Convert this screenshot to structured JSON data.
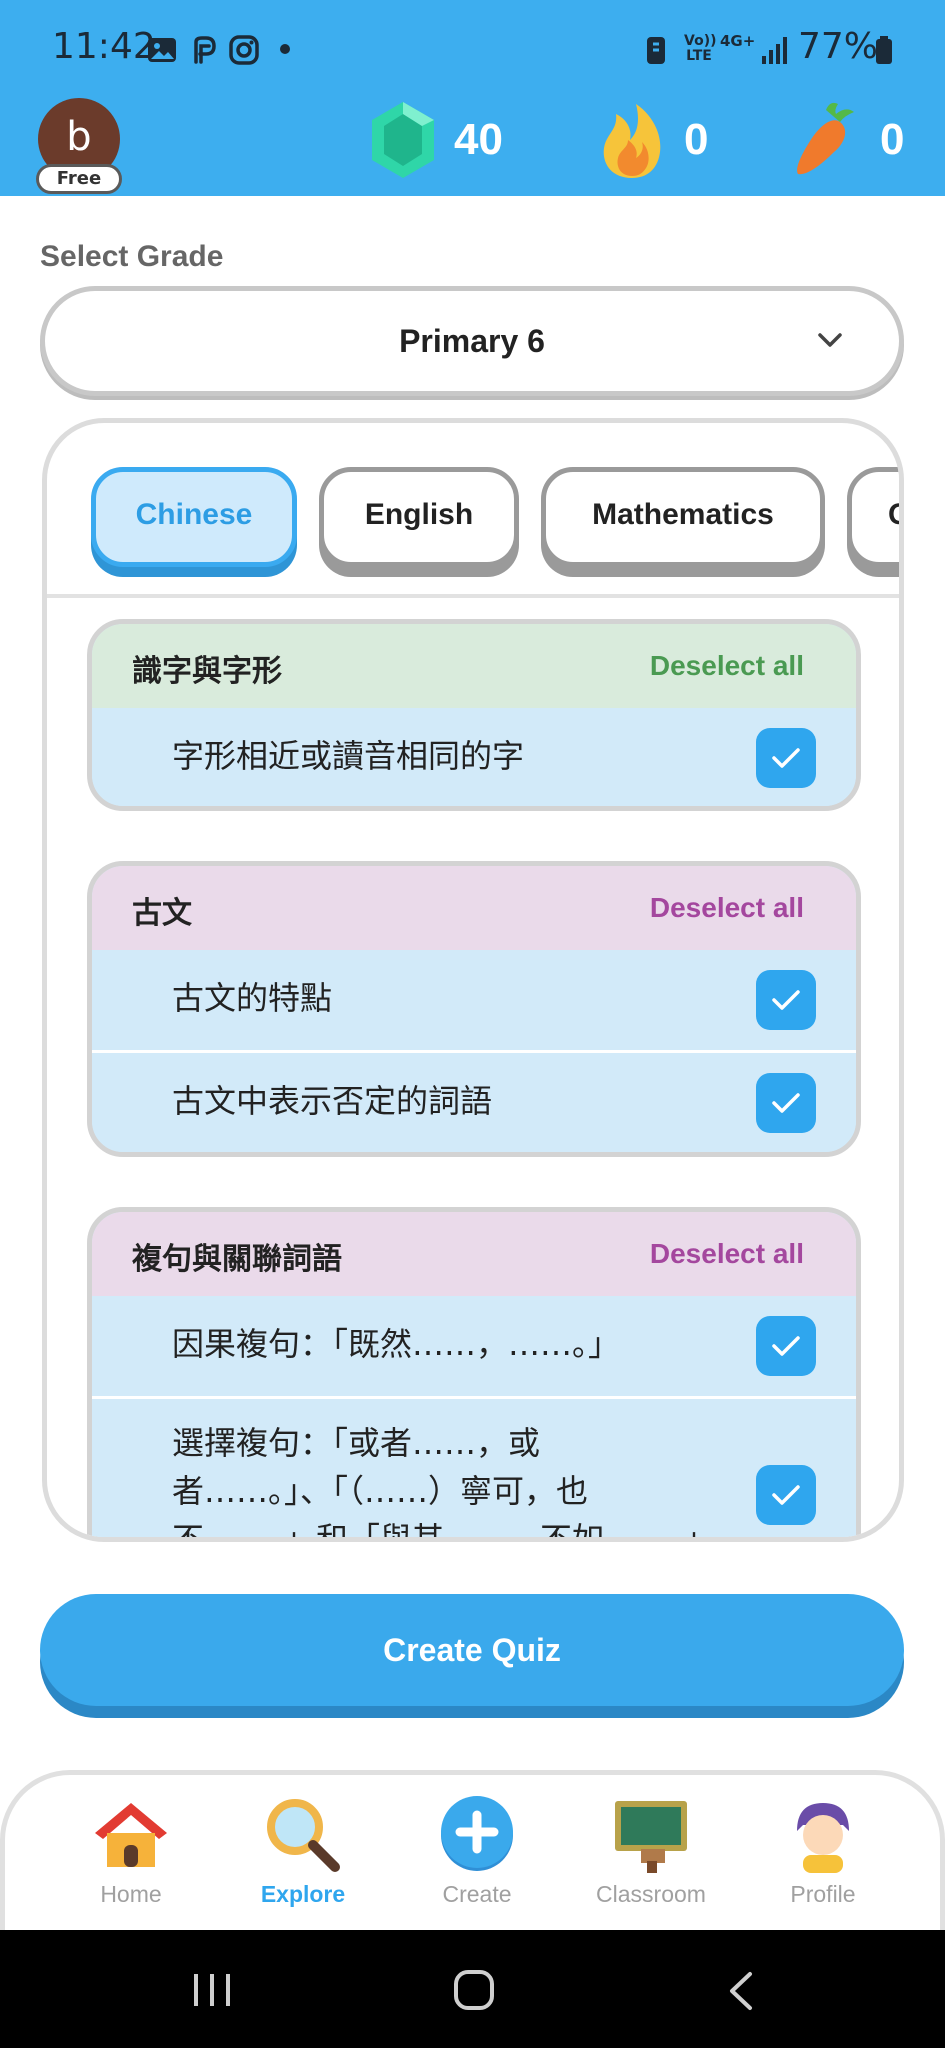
{
  "status_bar": {
    "time": "11:42",
    "signal_lte": "Vo)) LTE",
    "signal_4g": "4G+",
    "battery": "77%"
  },
  "header": {
    "avatar_letter": "b",
    "plan_badge": "Free",
    "gems": "40",
    "streak": "0",
    "carrots": "0"
  },
  "grade": {
    "label": "Select Grade",
    "selected": "Primary 6"
  },
  "subjects": [
    {
      "label": "Chinese",
      "active": true
    },
    {
      "label": "English",
      "active": false
    },
    {
      "label": "Mathematics",
      "active": false
    },
    {
      "label": "G",
      "active": false
    }
  ],
  "topic_groups": [
    {
      "title": "識字與字形",
      "action": "Deselect all",
      "head_color": "#d9ebdc",
      "action_color": "#4a9a52",
      "items": [
        {
          "label": "字形相近或讀音相同的字",
          "checked": true
        }
      ]
    },
    {
      "title": "古文",
      "action": "Deselect all",
      "head_color": "#eadaea",
      "action_color": "#a4479e",
      "items": [
        {
          "label": "古文的特點",
          "checked": true
        },
        {
          "label": "古文中表示否定的詞語",
          "checked": true
        }
      ]
    },
    {
      "title": "複句與關聯詞語",
      "action": "Deselect all",
      "head_color": "#eadaea",
      "action_color": "#a4479e",
      "items": [
        {
          "label": "因果複句：「既然……，……。」",
          "checked": true
        },
        {
          "label_line1": "選擇複句：「或者……，或",
          "label_line2": "者……。」、「（……）寧可，也",
          "label_line3": "不……。」和「與其……，不如……。」",
          "checked": true
        }
      ]
    }
  ],
  "create_button": "Create Quiz",
  "bottom_nav": [
    {
      "label": "Home",
      "icon": "home-icon",
      "active": false
    },
    {
      "label": "Explore",
      "icon": "magnifier-icon",
      "active": true
    },
    {
      "label": "Create",
      "icon": "plus-circle-icon",
      "active": false
    },
    {
      "label": "Classroom",
      "icon": "chalkboard-icon",
      "active": false
    },
    {
      "label": "Profile",
      "icon": "person-icon",
      "active": false
    }
  ],
  "colors": {
    "brand_blue": "#3daeef",
    "accent_blue": "#2fa6ee",
    "header_text": "#ffffff"
  }
}
